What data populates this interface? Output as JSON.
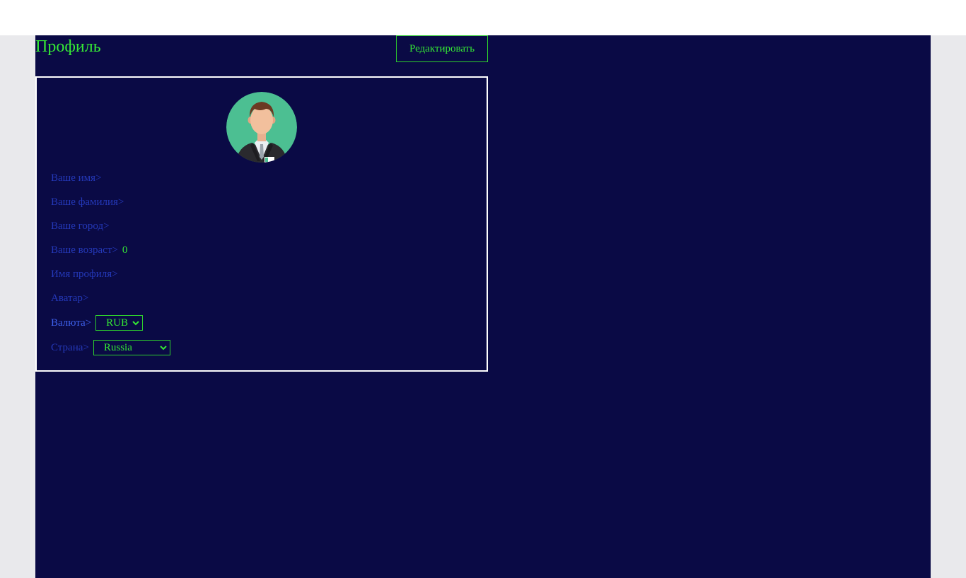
{
  "header": {
    "title": "Профиль",
    "edit_label": "Редактировать"
  },
  "profile": {
    "avatar_icon": "user-avatar-icon",
    "fields": {
      "first_name_label": "Ваше имя>",
      "last_name_label": "Ваше фамилия>",
      "city_label": "Ваше город>",
      "age_label": "Ваше возраст>",
      "age_value": "0",
      "profile_name_label": "Имя профиля>",
      "avatar_label": "Аватар>",
      "currency_label": "Валюта>",
      "currency_value": "RUB",
      "country_label": "Страна>",
      "country_value": "Russia"
    }
  },
  "colors": {
    "background": "#0a0a45",
    "accent": "#35e835",
    "label": "#2438b8",
    "border": "#ffffff"
  }
}
